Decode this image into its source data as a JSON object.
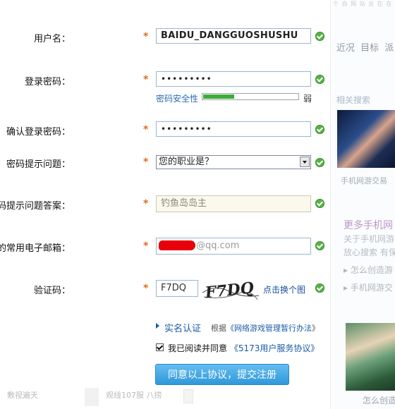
{
  "form": {
    "username": {
      "label": "用户名：",
      "value": "BAIDU_DANGGUOSHUSHU"
    },
    "password": {
      "label": "登录密码：",
      "value": "•••••••••"
    },
    "strength": {
      "label": "密码安全性",
      "word": "弱",
      "level": 0.33
    },
    "confirm": {
      "label": "确认登录密码：",
      "value": "•••••••••"
    },
    "question": {
      "label": "密码提示问题：",
      "selected": "您的职业是？"
    },
    "answer": {
      "label": "密码提示问题答案：",
      "value": "钓鱼岛岛主"
    },
    "email": {
      "label": "您的常用电子邮箱：",
      "suffix": "@qq.com"
    },
    "captcha": {
      "label": "验证码：",
      "value": "F7DQ",
      "image_text": "F7DQ",
      "refresh": "点击换个图"
    },
    "required_mark": "*",
    "auth": {
      "link": "实名认证",
      "basis_prefix": "根据",
      "basis_link": "《网络游戏管理暂行办法",
      "basis_suffix": "》"
    },
    "agree": {
      "text": "我已阅读并同意",
      "link": "《5173用户服务协议》",
      "checked": true
    },
    "submit_label": "同意以上协议，提交注册"
  },
  "bottom": {
    "left": "敷视遍天",
    "mid": "观线107服 八捞"
  },
  "right": {
    "header": "个 自 网 站 总 在 在 在 在 在 在",
    "tabs": "近况 目标 派",
    "related_title": "相关搜索",
    "caption1": "手机网游交易",
    "more": "更多手机网",
    "line1": "关于手机网游",
    "line2": "放心搜索 有保",
    "q1": "怎么创造游",
    "q2": "手机网游交",
    "caption2": "怎么创造"
  },
  "colors": {
    "accent": "#2f98d9",
    "ok": "#58b347",
    "required": "#e36a1d",
    "link": "#1a5aa5"
  }
}
